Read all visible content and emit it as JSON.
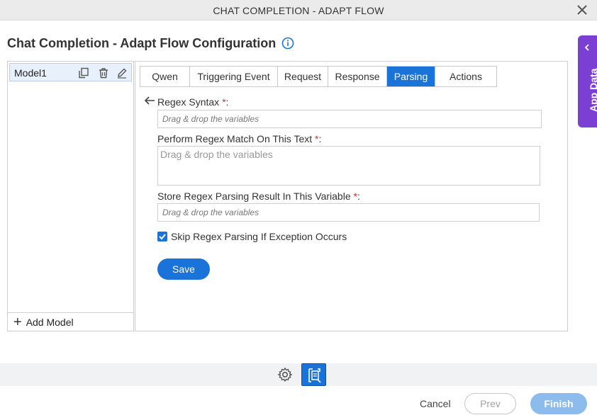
{
  "window": {
    "title": "CHAT COMPLETION - ADAPT FLOW"
  },
  "header": {
    "title": "Chat Completion - Adapt Flow Configuration"
  },
  "models": {
    "items": [
      {
        "label": "Model1"
      }
    ],
    "add_label": "Add Model"
  },
  "tabs": [
    {
      "label": "Qwen",
      "active": false
    },
    {
      "label": "Triggering Event",
      "active": false
    },
    {
      "label": "Request",
      "active": false
    },
    {
      "label": "Response",
      "active": false
    },
    {
      "label": "Parsing",
      "active": true
    },
    {
      "label": "Actions",
      "active": false
    }
  ],
  "form": {
    "regex_syntax": {
      "label": "Regex Syntax",
      "required_mark": "*",
      "suffix": ":",
      "placeholder": "Drag & drop the variables"
    },
    "match_text": {
      "label": "Perform Regex Match On This Text",
      "required_mark": "*",
      "suffix": ":",
      "placeholder": "Drag & drop the variables"
    },
    "store_result": {
      "label": "Store Regex Parsing Result In This Variable",
      "required_mark": "*",
      "suffix": ":",
      "placeholder": "Drag & drop the variables"
    },
    "skip_on_exception": {
      "label": "Skip Regex Parsing If Exception Occurs",
      "checked": true
    },
    "save_label": "Save"
  },
  "side_tab": {
    "label": "App Data"
  },
  "footer": {
    "cancel": "Cancel",
    "prev": "Prev",
    "finish": "Finish"
  },
  "colors": {
    "primary": "#1a73d8",
    "side_tab": "#7b3fd4",
    "required": "#d32f2f",
    "finish_disabled": "#8cbbee"
  }
}
